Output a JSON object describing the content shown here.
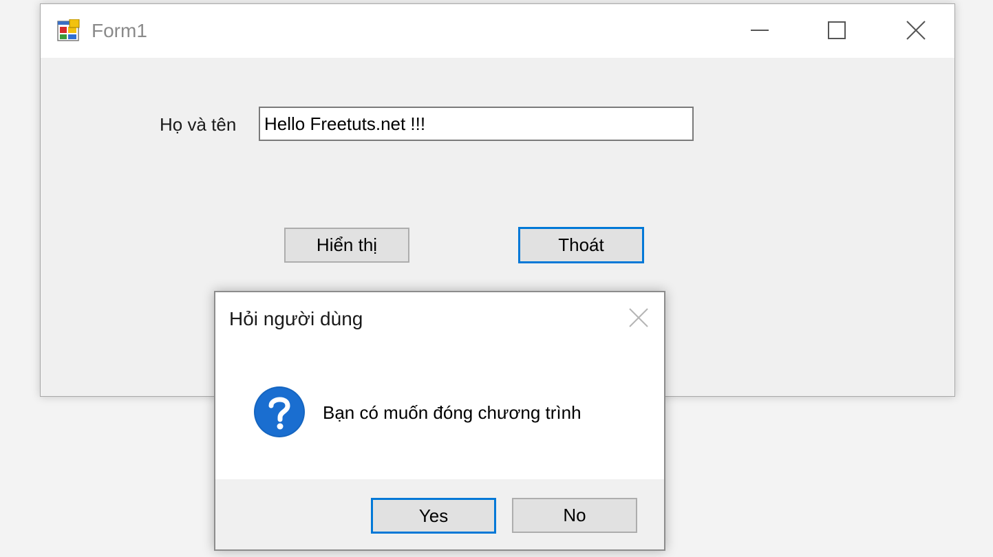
{
  "main_window": {
    "title": "Form1",
    "name_label": "Họ và tên",
    "name_value": "Hello Freetuts.net !!!",
    "show_button": "Hiển thị",
    "exit_button": "Thoát"
  },
  "dialog": {
    "title": "Hỏi người dùng",
    "message": "Bạn có muốn đóng chương trình",
    "icon": "question-icon",
    "yes_button": "Yes",
    "no_button": "No"
  },
  "colors": {
    "accent": "#0078d7",
    "window_bg": "#f0f0f0",
    "titlebar_bg": "#ffffff",
    "question_icon": "#1565c0"
  },
  "icons": {
    "app": "winforms-app-icon",
    "minimize": "minimize-icon",
    "maximize": "maximize-icon",
    "close": "close-icon"
  }
}
